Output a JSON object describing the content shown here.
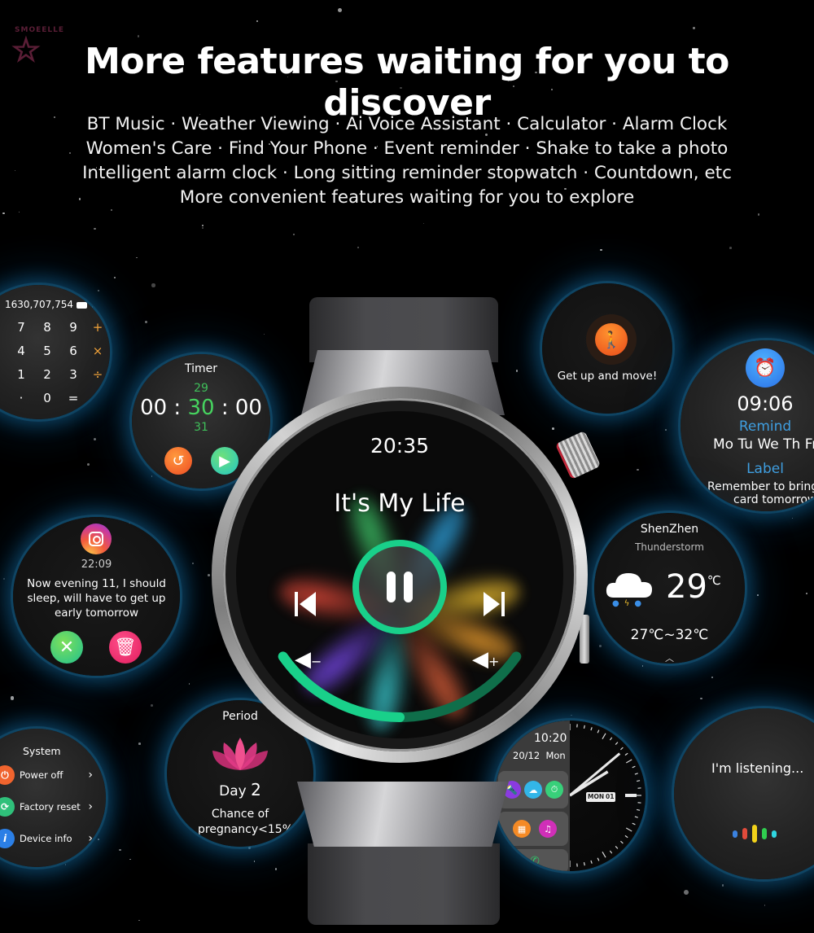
{
  "brand": {
    "logo_text": "SMOEELLE",
    "logo_icon": "star-outline-icon"
  },
  "header": {
    "title": "More features waiting for you to discover",
    "features_lines": [
      "BT Music · Weather Viewing · Ai Voice Assistant · Calculator · Alarm Clock",
      "Women's Care · Find Your Phone · Event reminder · Shake to take a photo",
      "Intelligent alarm clock · Long sitting reminder stopwatch · Countdown, etc",
      "More convenient features waiting for you to explore"
    ]
  },
  "calculator": {
    "display": "1630,707,754",
    "backspace_icon": "backspace-icon",
    "keys": [
      "7",
      "8",
      "9",
      "+",
      "4",
      "5",
      "6",
      "×",
      "1",
      "2",
      "3",
      "÷",
      "·",
      "0",
      "="
    ],
    "operator_color": "#f2a33a"
  },
  "timer": {
    "title": "Timer",
    "hours": "00",
    "minutes": "30",
    "seconds": "00",
    "minutes_prev": "29",
    "minutes_next": "31",
    "separator": ":",
    "accent_color": "#46d35f",
    "reset_icon": "reset-icon",
    "play_icon": "play-icon"
  },
  "sedentary": {
    "icon": "person-stretch-icon",
    "message": "Get up and move!"
  },
  "alarm": {
    "icon": "alarm-clock-icon",
    "time": "09:06",
    "remind_label": "Remind",
    "days": "Mo Tu We Th Fr",
    "label_title": "Label",
    "note_line1": "Remember to bring",
    "note_line2": "card tomorrow",
    "accent_color": "#3f9ee0"
  },
  "weather": {
    "city": "ShenZhen",
    "condition": "Thunderstorm",
    "icon": "thunderstorm-cloud-icon",
    "temperature": "29",
    "unit": "℃",
    "range": "27℃~32℃",
    "expand_icon": "chevron-up-icon"
  },
  "notification": {
    "app_icon": "instagram-icon",
    "time": "22:09",
    "message": "Now evening 11, I should sleep, will have to get up early tomorrow",
    "dismiss_icon": "close-icon",
    "delete_icon": "trash-icon"
  },
  "system_menu": {
    "title": "System",
    "items": [
      {
        "label": "Power off",
        "icon": "power-icon",
        "color": "#f0642e"
      },
      {
        "label": "Factory reset",
        "icon": "refresh-icon",
        "color": "#2fc07a"
      },
      {
        "label": "Device info",
        "icon": "info-icon",
        "color": "#2b7fe6"
      }
    ],
    "chevron": "›"
  },
  "period": {
    "title": "Period",
    "icon": "lotus-icon",
    "day_label": "Day",
    "day_value": "2",
    "chance": "Chance of pregnancy<15%"
  },
  "watchface": {
    "time": "10:20",
    "date": "20/12  Mon",
    "day_box": "MON",
    "date_box": "01",
    "apps": [
      "flashlight-icon",
      "weather-icon",
      "stopwatch-icon",
      "calculator-icon",
      "voice-icon",
      "phone-icon"
    ]
  },
  "voice_assistant": {
    "message": "I'm listening...",
    "bar_colors": [
      "#3b82e0",
      "#e24b3b",
      "#f2d21a",
      "#2fcf4f",
      "#2fd6e0"
    ]
  },
  "music_player": {
    "clock": "20:35",
    "song_title": "It's My Life",
    "pause_icon": "pause-icon",
    "prev_icon": "skip-previous-icon",
    "next_icon": "skip-next-icon",
    "volume_down_icon": "volume-down-icon",
    "volume_up_icon": "volume-up-icon",
    "volume_level": 0.5,
    "accent_color": "#19d08a"
  }
}
